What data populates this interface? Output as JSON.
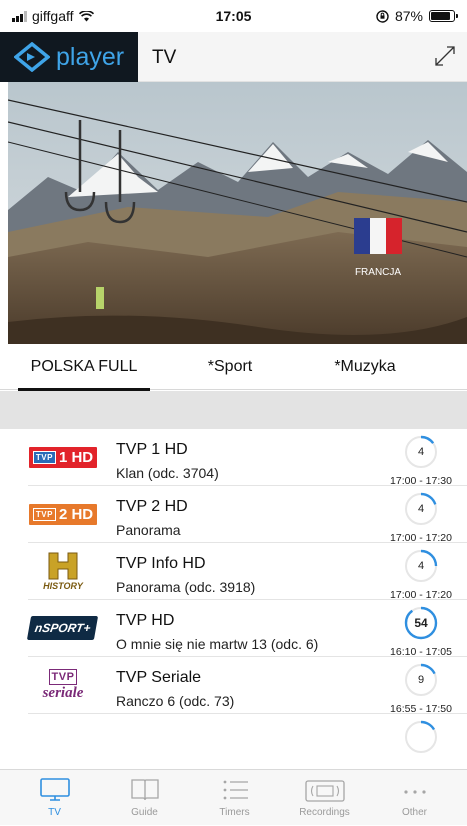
{
  "status": {
    "carrier": "giffgaff",
    "time": "17:05",
    "battery": "87%",
    "battery_level": 0.87
  },
  "header": {
    "brand": "player",
    "title": "TV"
  },
  "video": {
    "overlay_text": "FRANCJA"
  },
  "tabs": [
    {
      "label": "POLSKA FULL",
      "active": true
    },
    {
      "label": "*Sport",
      "active": false
    },
    {
      "label": "*Muzyka",
      "active": false
    }
  ],
  "channels": [
    {
      "logo": "TVP 1 HD",
      "logo_text": "1 HD",
      "name": "TVP 1 HD",
      "program": "Klan (odc. 3704)",
      "remaining": "4",
      "progress": 0.15,
      "time": "17:00 - 17:30",
      "logo_color": "#e2232a"
    },
    {
      "logo": "TVP 2 HD",
      "logo_text": "2 HD",
      "name": "TVP 2 HD",
      "program": "Panorama",
      "remaining": "4",
      "progress": 0.2,
      "time": "17:00 - 17:20",
      "logo_color": "#e7792b"
    },
    {
      "logo": "HISTORY",
      "logo_text": "HISTORY",
      "name": "TVP Info HD",
      "program": "Panorama (odc. 3918)",
      "remaining": "4",
      "progress": 0.25,
      "time": "17:00 - 17:20",
      "logo_color": "#c9a227"
    },
    {
      "logo": "NSPORT+",
      "logo_text": "nSPORT+",
      "name": "TVP HD",
      "program": "O mnie się nie martw 13 (odc. 6)",
      "remaining": "54",
      "progress": 0.9,
      "time": "16:10 - 17:05",
      "logo_color": "#0f2a44"
    },
    {
      "logo": "TVP seriale",
      "logo_text": "seriale",
      "name": "TVP Seriale",
      "program": "Ranczo 6 (odc. 73)",
      "remaining": "9",
      "progress": 0.18,
      "time": "16:55 - 17:50",
      "logo_color": "#7b2a78"
    }
  ],
  "nav": [
    {
      "label": "TV",
      "icon": "tv-icon",
      "active": true
    },
    {
      "label": "Guide",
      "icon": "book-icon",
      "active": false
    },
    {
      "label": "Timers",
      "icon": "list-icon",
      "active": false
    },
    {
      "label": "Recordings",
      "icon": "tape-icon",
      "active": false
    },
    {
      "label": "Other",
      "icon": "more-icon",
      "active": false
    }
  ],
  "colors": {
    "accent": "#2f8fe0",
    "brand": "#3fa4e8",
    "header_dark": "#101820"
  }
}
